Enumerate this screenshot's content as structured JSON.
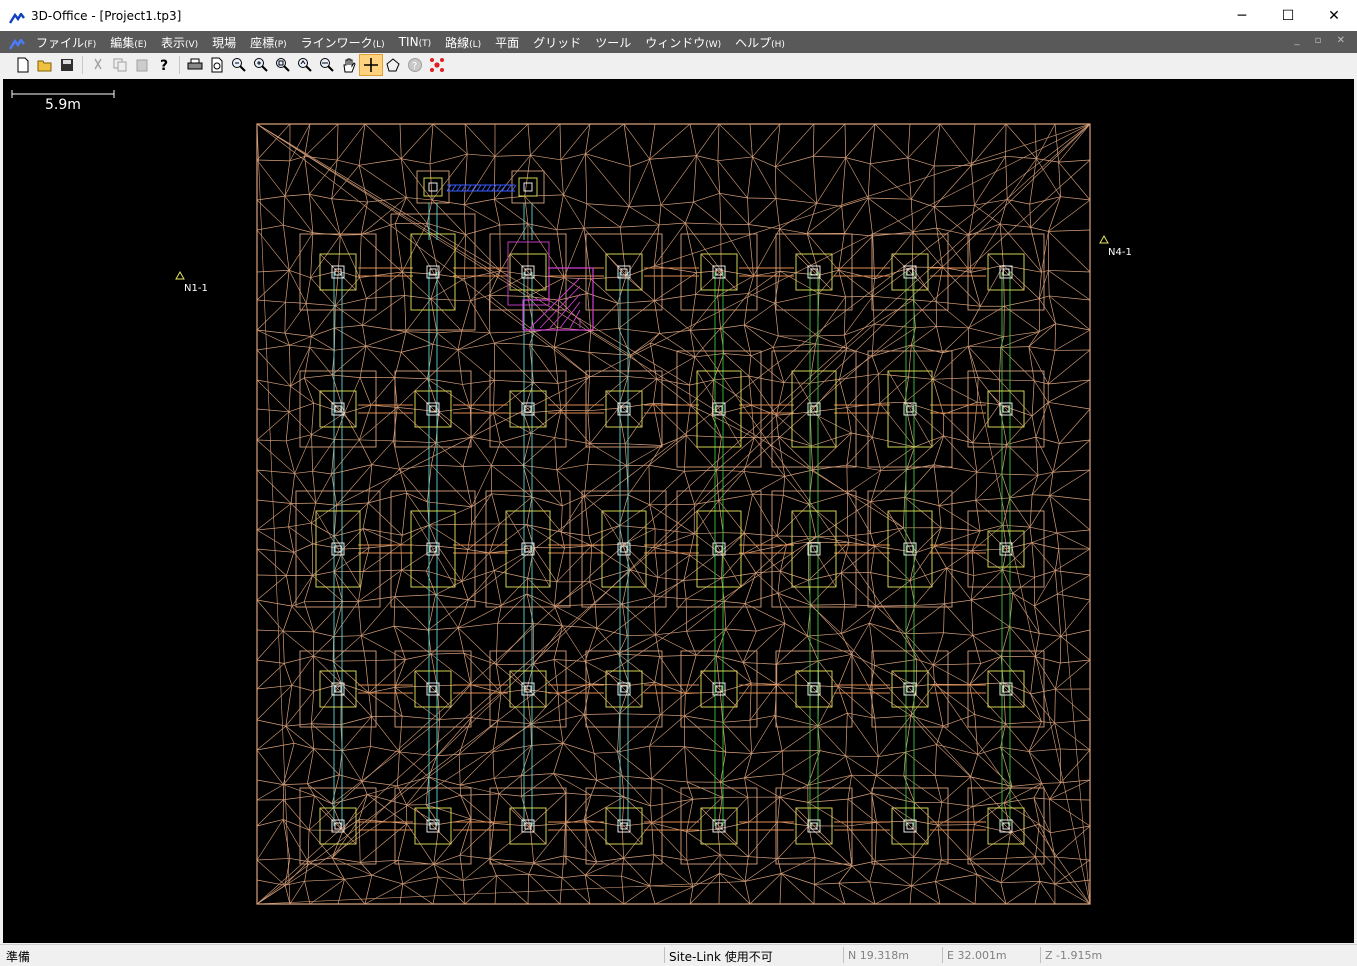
{
  "window": {
    "title": "3D-Office - [Project1.tp3]",
    "minimize": "─",
    "maximize": "☐",
    "close": "✕"
  },
  "menu": [
    {
      "label": "ファイル",
      "acc": "(F)"
    },
    {
      "label": "編集",
      "acc": "(E)"
    },
    {
      "label": "表示",
      "acc": "(V)"
    },
    {
      "label": "現場",
      "acc": ""
    },
    {
      "label": "座標",
      "acc": "(P)"
    },
    {
      "label": "ラインワーク",
      "acc": "(L)"
    },
    {
      "label": "TIN",
      "acc": "(T)"
    },
    {
      "label": "路線",
      "acc": "(L)"
    },
    {
      "label": "平面",
      "acc": ""
    },
    {
      "label": "グリッド",
      "acc": ""
    },
    {
      "label": "ツール",
      "acc": ""
    },
    {
      "label": "ウィンドウ",
      "acc": "(W)"
    },
    {
      "label": "ヘルプ",
      "acc": "(H)"
    }
  ],
  "mdi_buttons": "_ ▫ ✕",
  "toolbar": {
    "buttons": [
      "new-file-icon",
      "open-folder-icon",
      "save-icon",
      "cut-icon",
      "copy-icon",
      "paste-icon",
      "help-query-icon",
      "print-icon",
      "print-preview-icon",
      "zoom-out-icon",
      "zoom-in-icon",
      "zoom-window-icon",
      "zoom-previous-icon",
      "zoom-all-icon",
      "pan-hand-icon",
      "crosshair-icon",
      "polygon-icon",
      "info-icon",
      "snap-icon"
    ],
    "active": "crosshair-icon"
  },
  "canvas": {
    "scale_text": "5.9m",
    "points": [
      {
        "name": "N1-1"
      },
      {
        "name": "N4-1"
      }
    ],
    "colors": {
      "tin": "#d8a07a",
      "pad": "#e6e65a",
      "cyan": "#5fd6d6",
      "green": "#3ec63e",
      "magenta": "#d040d0",
      "blue": "#3a5cff"
    }
  },
  "status": {
    "ready": "準備",
    "sitelink": "Site-Link 使用不可",
    "north": "N 19.318m",
    "east": "E 32.001m",
    "z": "Z -1.915m"
  }
}
